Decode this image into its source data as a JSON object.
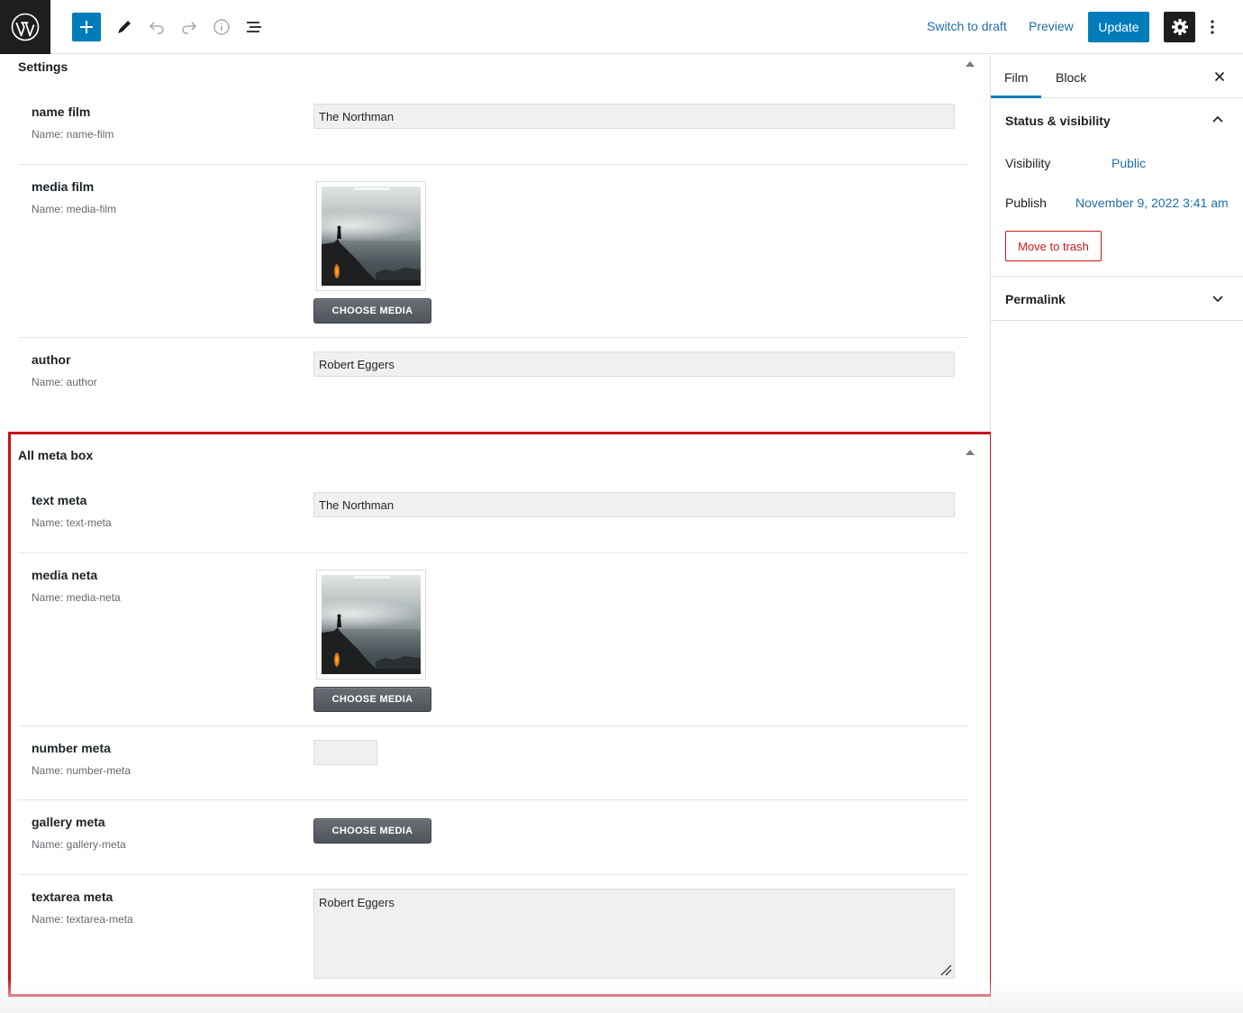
{
  "toolbar": {
    "switch_to_draft": "Switch to draft",
    "preview": "Preview",
    "update": "Update"
  },
  "settings_box": {
    "title": "Settings",
    "fields": {
      "name_film": {
        "label": "name film",
        "name": "Name: name-film",
        "value": "The Northman"
      },
      "media_film": {
        "label": "media film",
        "name": "Name: media-film",
        "button": "CHOOSE MEDIA"
      },
      "author": {
        "label": "author",
        "name": "Name: author",
        "value": "Robert Eggers"
      }
    }
  },
  "meta_box": {
    "title": "All meta box",
    "fields": {
      "text_meta": {
        "label": "text meta",
        "name": "Name: text-meta",
        "value": "The Northman"
      },
      "media_neta": {
        "label": "media neta",
        "name": "Name: media-neta",
        "button": "CHOOSE MEDIA"
      },
      "number_meta": {
        "label": "number meta",
        "name": "Name: number-meta",
        "value": ""
      },
      "gallery_meta": {
        "label": "gallery meta",
        "name": "Name: gallery-meta",
        "button": "CHOOSE MEDIA"
      },
      "textarea_meta": {
        "label": "textarea meta",
        "name": "Name: textarea-meta",
        "value": "Robert Eggers"
      }
    }
  },
  "sidebar": {
    "tabs": [
      "Film",
      "Block"
    ],
    "status_panel": {
      "title": "Status & visibility",
      "visibility_label": "Visibility",
      "visibility_value": "Public",
      "publish_label": "Publish",
      "publish_value": "November 9, 2022 3:41 am",
      "trash": "Move to trash"
    },
    "permalink_title": "Permalink"
  },
  "colors": {
    "accent": "#007cba",
    "highlight": "#c8101a",
    "trash": "#cc1818"
  }
}
